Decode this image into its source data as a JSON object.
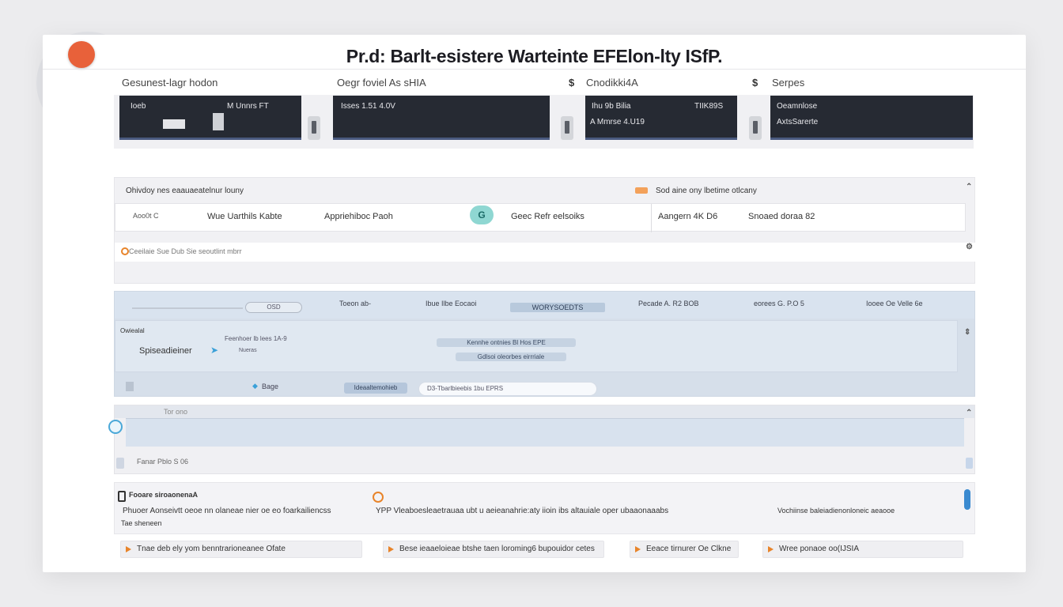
{
  "app": {
    "title": "Pr.d: Barlt-esistere Warteinte EFElon-lty ISfP."
  },
  "previews": {
    "labels": [
      "Gesunest-lagr hodon",
      "Oegr foviel As sHIA",
      "Cnodikki4A",
      "Serpes"
    ],
    "markers": [
      "$",
      "$"
    ],
    "cards": [
      {
        "line1": "Ioeb",
        "line2": "M Unnrs FT"
      },
      {
        "line1": "Isses 1.51 4.0V"
      },
      {
        "line1": "Ihu 9b  Bilia",
        "line2": "A Mmrse 4.U19",
        "right": "TIIK89S"
      },
      {
        "line1": "Oeamnlose",
        "line2": "AxtsSarerte"
      }
    ]
  },
  "panel1": {
    "header_left": "Ohivdoy nes eaauaeatelnur louny",
    "header_right": "Sod aine ony lbetime otlcany",
    "row": {
      "cells": [
        "Aoo0t C",
        "Wue Uarthils Kabte",
        "Appriehiboc Paoh",
        "Geec Refr eelsoiks",
        "Aangern 4K D6",
        "Snoaed doraa 82"
      ],
      "badge": "G"
    },
    "note": "Ceeilaie Sue Dub Sie seoutlint mbrr"
  },
  "panel2": {
    "header": {
      "slider_value": "OSD",
      "cells": [
        "Toeon ab-",
        "Ibue  Ilbe Eocaoi",
        "WORYSOEDTS",
        "Pecade A. R2 BOB",
        "eorees G. P.O 5",
        "Iooee Oe Velle 6e"
      ]
    },
    "sub": {
      "label_top": "Owiealal",
      "label_main": "Spiseadieiner",
      "caption": "Nueras",
      "pill_top": "Kennhe ontnies Bl Hos EPE",
      "pill_bottom": "Gdlsoi oleorbes eirrriale",
      "small_text": "Feenhoer lb lees   1A-9"
    },
    "bottom": {
      "left": "Bage",
      "blue_pill": "Ideaaltemohieb",
      "white_pill": "D3-Tbarlbieebis  1bu EPRS"
    }
  },
  "panel3": {
    "top": "Tor  ono",
    "label": "Fanar  Pblo S 06"
  },
  "panel4": {
    "title": "Fooare siroaonenaA",
    "body_left": "Phuoer Aonseivtt oeoe nn olaneae nier oe eo foarkailiencss",
    "body_mid": "YPP Vleaboesleaetrauaa ubt u aeieanahrie:aty  iioin ibs altauiale  oper ubaaonaaabs",
    "body_right": "Vochiinse baleiadienonloneic aeaooe",
    "sub": "Tae sheneen"
  },
  "actions": [
    "Tnae deb ely yom benntrarioneanee Ofate",
    "Bese ieaaeloieae btshe  taen loroming6  bupouidor cetes",
    "Eeace tirnurer  Oe Clkne",
    "Wree ponaoe oo(IJSIA"
  ],
  "colors": {
    "accent": "#e8613a",
    "dark_card": "#262a33",
    "teal": "#8fd7d2",
    "panel_blue": "#d6dfea"
  }
}
